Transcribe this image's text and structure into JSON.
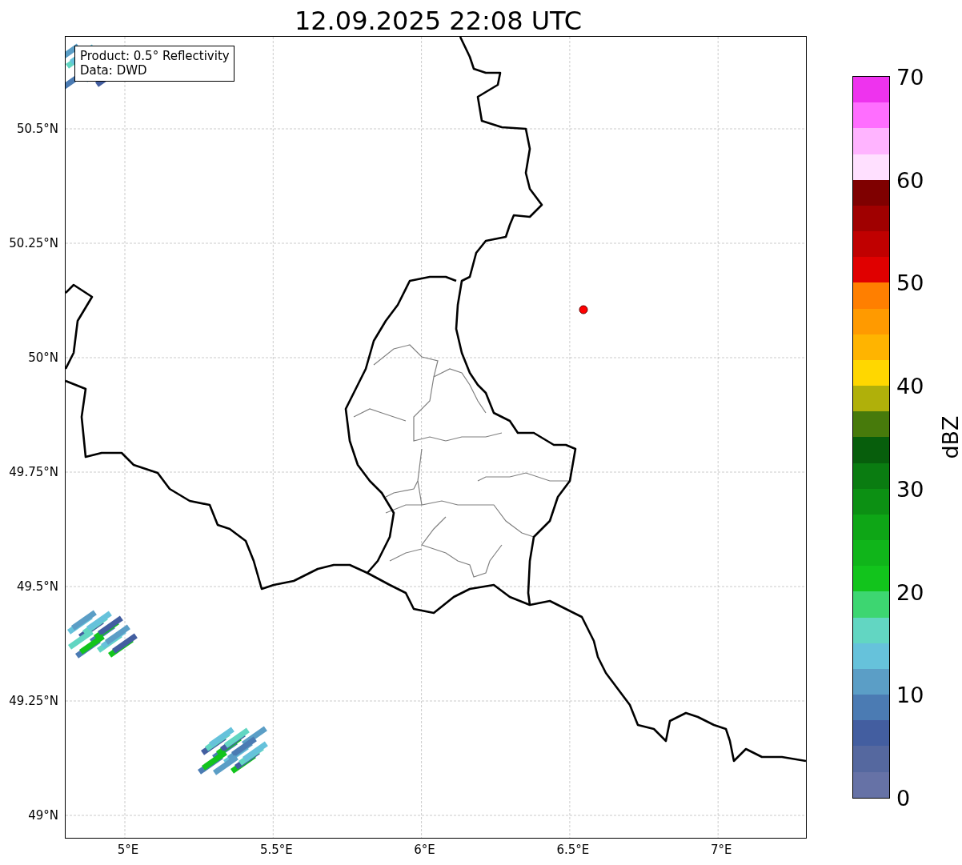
{
  "title": "12.09.2025 22:08 UTC",
  "info_box": {
    "lines": [
      "Product: 0.5° Reflectivity",
      "Data: DWD"
    ]
  },
  "latitude_labels": [
    "50.5°N",
    "50.25°N",
    "50°N",
    "49.75°N",
    "49.5°N",
    "49.25°N",
    "49°N"
  ],
  "longitude_labels": [
    "5°E",
    "5.5°E",
    "6°E",
    "6.5°E",
    "7°E"
  ],
  "colorbar": {
    "label": "dBZ",
    "ticks": [
      "70",
      "60",
      "50",
      "40",
      "30",
      "20",
      "10",
      "0"
    ],
    "bands": [
      {
        "color": "#ee33ee"
      },
      {
        "color": "#ff6eff"
      },
      {
        "color": "#ffb4ff"
      },
      {
        "color": "#ffe0ff"
      },
      {
        "color": "#7f0000"
      },
      {
        "color": "#a00000"
      },
      {
        "color": "#c00000"
      },
      {
        "color": "#e00000"
      },
      {
        "color": "#ff7f00"
      },
      {
        "color": "#ff9a00"
      },
      {
        "color": "#ffb400"
      },
      {
        "color": "#ffd700"
      },
      {
        "color": "#b0b00a"
      },
      {
        "color": "#477a0b"
      },
      {
        "color": "#075e0c"
      },
      {
        "color": "#0a7c11"
      },
      {
        "color": "#0c9013"
      },
      {
        "color": "#0ea616"
      },
      {
        "color": "#10b51a"
      },
      {
        "color": "#12c41c"
      },
      {
        "color": "#3dd671"
      },
      {
        "color": "#62d6c2"
      },
      {
        "color": "#66c2db"
      },
      {
        "color": "#5b9ec6"
      },
      {
        "color": "#4b7bb3"
      },
      {
        "color": "#435ea0"
      },
      {
        "color": "#55689f"
      },
      {
        "color": "#6672a6"
      }
    ]
  }
}
